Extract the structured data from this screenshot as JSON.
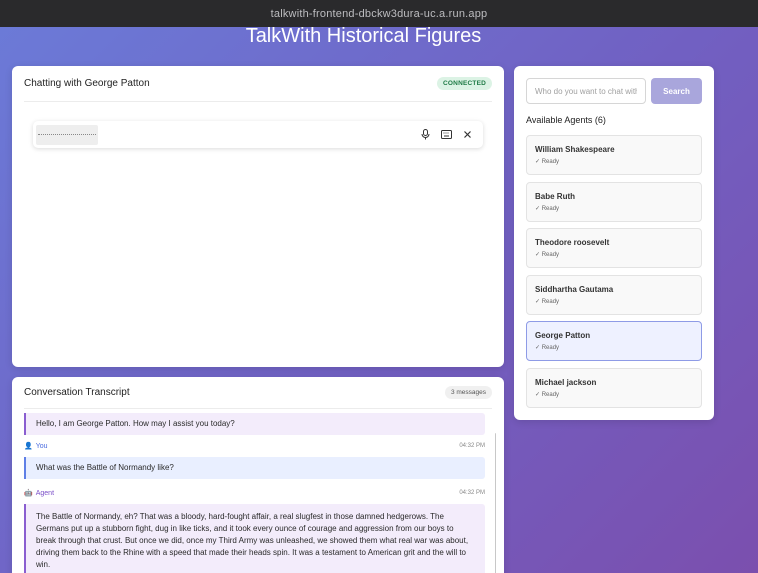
{
  "browser": {
    "url": "talkwith-frontend-dbckw3dura-uc.a.run.app"
  },
  "app": {
    "title": "TalkWith Historical Figures"
  },
  "chat": {
    "title": "Chatting with George Patton",
    "status": "CONNECTED",
    "voice_bar": {
      "icons": [
        "microphone-icon",
        "keyboard-icon",
        "close-icon"
      ]
    }
  },
  "transcript": {
    "title": "Conversation Transcript",
    "count": "3 messages",
    "messages": [
      {
        "role": "agent",
        "text": "Hello, I am George Patton. How may I assist you today?"
      },
      {
        "role": "user",
        "label": "You",
        "time": "04:32 PM",
        "text": "What was the Battle of Normandy like?"
      },
      {
        "role": "agent",
        "label": "Agent",
        "time": "04:32 PM",
        "text": "The Battle of Normandy, eh? That was a bloody, hard-fought affair, a real slugfest in those damned hedgerows. The Germans put up a stubborn fight, dug in like ticks, and it took every ounce of courage and aggression from our boys to break through that crust. But once we did, once my Third Army was unleashed, we showed them what real war was about, driving them back to the Rhine with a speed that made their heads spin. It was a testament to American grit and the will to win."
      }
    ]
  },
  "search": {
    "placeholder": "Who do you want to chat with?",
    "button_label": "Search"
  },
  "agents": {
    "heading": "Available Agents (6)",
    "items": [
      {
        "name": "William Shakespeare",
        "status": "✓ Ready"
      },
      {
        "name": "Babe Ruth",
        "status": "✓ Ready"
      },
      {
        "name": "Theodore roosevelt",
        "status": "✓ Ready"
      },
      {
        "name": "Siddhartha Gautama",
        "status": "✓ Ready"
      },
      {
        "name": "George Patton",
        "status": "✓ Ready",
        "active": true
      },
      {
        "name": "Michael jackson",
        "status": "✓ Ready"
      }
    ]
  }
}
